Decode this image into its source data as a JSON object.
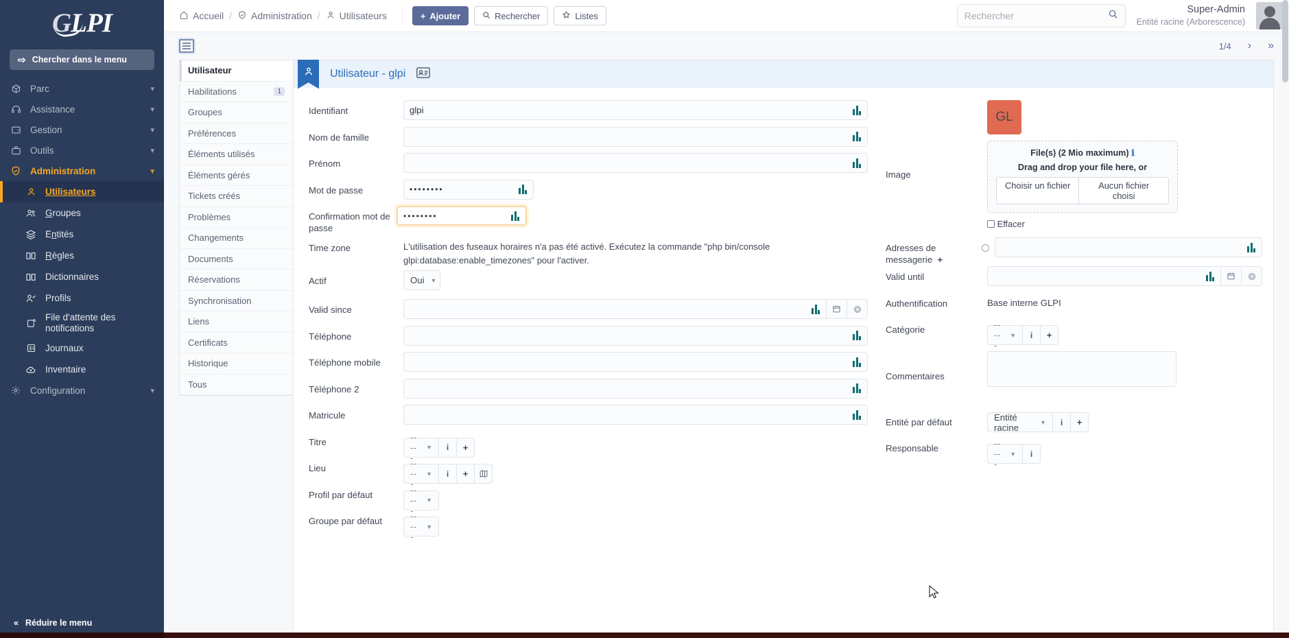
{
  "brand": {
    "logo_text_g": "G",
    "logo_text_rest": "LPI"
  },
  "sidebar": {
    "search_label": "Chercher dans le menu",
    "items": [
      {
        "label": "Parc",
        "icon": "box-icon"
      },
      {
        "label": "Assistance",
        "icon": "headset-icon"
      },
      {
        "label": "Gestion",
        "icon": "wallet-icon"
      },
      {
        "label": "Outils",
        "icon": "briefcase-icon"
      },
      {
        "label": "Administration",
        "icon": "shield-icon"
      },
      {
        "label": "Configuration",
        "icon": "gear-icon"
      }
    ],
    "admin_children": [
      {
        "label": "Utilisateurs",
        "icon": "user-icon"
      },
      {
        "label": "Groupes",
        "icon": "users-icon"
      },
      {
        "label": "Entités",
        "icon": "layers-icon"
      },
      {
        "label": "Règles",
        "icon": "book-icon"
      },
      {
        "label": "Dictionnaires",
        "icon": "book-icon"
      },
      {
        "label": "Profils",
        "icon": "user-check-icon"
      },
      {
        "label": "File d'attente des notifications",
        "icon": "queue-icon"
      },
      {
        "label": "Journaux",
        "icon": "log-icon"
      },
      {
        "label": "Inventaire",
        "icon": "cloud-download-icon"
      }
    ],
    "collapse_label": "Réduire le menu"
  },
  "topbar": {
    "breadcrumb": [
      "Accueil",
      "Administration",
      "Utilisateurs"
    ],
    "buttons": {
      "add": "Ajouter",
      "search": "Rechercher",
      "lists": "Listes"
    },
    "search_placeholder": "Rechercher",
    "user_name": "Super-Admin",
    "user_entity": "Entité racine (Arborescence)"
  },
  "pager": {
    "position": "1/4",
    "next": "›",
    "last": "»"
  },
  "tabs": [
    {
      "label": "Utilisateur",
      "badge": ""
    },
    {
      "label": "Habilitations",
      "badge": "1"
    },
    {
      "label": "Groupes",
      "badge": ""
    },
    {
      "label": "Préférences",
      "badge": ""
    },
    {
      "label": "Éléments utilisés",
      "badge": ""
    },
    {
      "label": "Éléments gérés",
      "badge": ""
    },
    {
      "label": "Tickets créés",
      "badge": ""
    },
    {
      "label": "Problèmes",
      "badge": ""
    },
    {
      "label": "Changements",
      "badge": ""
    },
    {
      "label": "Documents",
      "badge": ""
    },
    {
      "label": "Réservations",
      "badge": ""
    },
    {
      "label": "Synchronisation",
      "badge": ""
    },
    {
      "label": "Liens",
      "badge": ""
    },
    {
      "label": "Certificats",
      "badge": ""
    },
    {
      "label": "Historique",
      "badge": ""
    },
    {
      "label": "Tous",
      "badge": ""
    }
  ],
  "form": {
    "header_title": "Utilisateur - glpi",
    "left": {
      "identifiant_label": "Identifiant",
      "identifiant_value": "glpi",
      "nom_label": "Nom de famille",
      "nom_value": "",
      "prenom_label": "Prénom",
      "prenom_value": "",
      "password_label": "Mot de passe",
      "password_value": "••••••••",
      "password_confirm_label": "Confirmation mot de passe",
      "password_confirm_value": "••••••••",
      "timezone_label": "Time zone",
      "timezone_help": "L'utilisation des fuseaux horaires n'a pas été activé. Exécutez la commande \"php bin/console glpi:database:enable_timezones\" pour l'activer.",
      "actif_label": "Actif",
      "actif_value": "Oui",
      "valid_since_label": "Valid since",
      "valid_since_value": "",
      "telephone_label": "Téléphone",
      "telephone_value": "",
      "mobile_label": "Téléphone mobile",
      "mobile_value": "",
      "telephone2_label": "Téléphone 2",
      "telephone2_value": "",
      "matricule_label": "Matricule",
      "matricule_value": "",
      "titre_label": "Titre",
      "titre_value": "-----",
      "lieu_label": "Lieu",
      "lieu_value": "-----",
      "profil_label": "Profil par défaut",
      "profil_value": "-----",
      "groupe_label": "Groupe par défaut",
      "groupe_value": "-----"
    },
    "right": {
      "image_label": "Image",
      "avatar_initials": "GL",
      "dropzone_files": "File(s) (2 Mio maximum)",
      "dropzone_drag": "Drag and drop your file here, or",
      "choose_file": "Choisir un fichier",
      "no_file": "Aucun fichier choisi",
      "effacer_label": "Effacer",
      "emails_label": "Adresses de messagerie",
      "emails_value": "",
      "valid_until_label": "Valid until",
      "valid_until_value": "",
      "auth_label": "Authentification",
      "auth_value": "Base interne GLPI",
      "categorie_label": "Catégorie",
      "categorie_value": "-----",
      "commentaires_label": "Commentaires",
      "commentaires_value": "",
      "entite_label": "Entité par défaut",
      "entite_value": "Entité racine",
      "responsable_label": "Responsable",
      "responsable_value": "-----"
    }
  },
  "colors": {
    "sidebar_bg": "#2b3d5b",
    "accent": "#f5a623",
    "primary": "#5b6c9a",
    "avatar": "#e06a52"
  }
}
